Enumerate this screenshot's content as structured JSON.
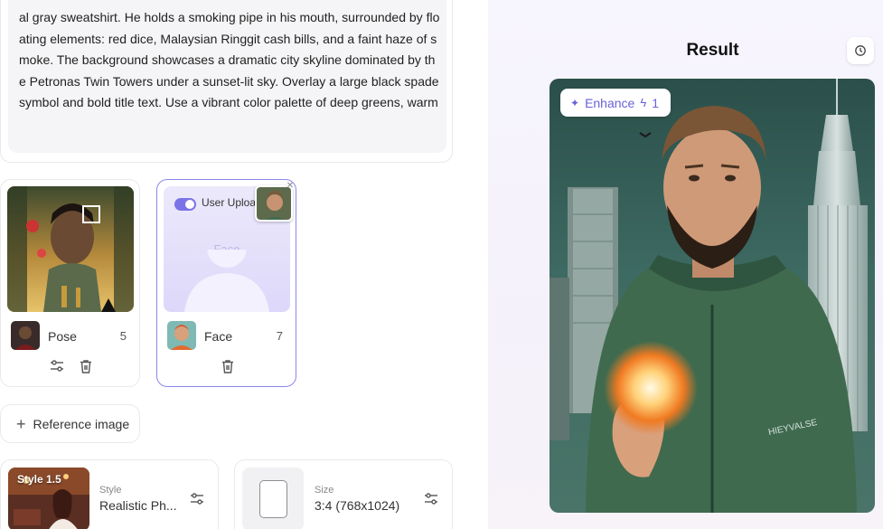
{
  "prompt": {
    "text": "al gray sweatshirt. He holds a smoking pipe in his mouth, surrounded by floating elements: red dice, Malaysian Ringgit cash bills, and a faint haze of smoke. The background showcases a dramatic city skyline dominated by the Petronas Twin Towers under a sunset-lit sky. Overlay a large black spade symbol and bold title text. Use a vibrant color palette of deep greens, warm oranges, and dark shadows to evoke themes of high-stakes gambling, urban intrigue"
  },
  "references": {
    "pose": {
      "name": "Pose",
      "count": "5"
    },
    "face": {
      "name": "Face",
      "count": "7",
      "toggle_label": "User Uploa",
      "placeholder_label": "Face"
    }
  },
  "reference_button": {
    "label": "Reference image"
  },
  "style_option": {
    "badge": "Style 1.5",
    "label": "Style",
    "value": "Realistic Ph..."
  },
  "size_option": {
    "label": "Size",
    "value": "3:4 (768x1024)"
  },
  "result": {
    "title": "Result",
    "enhance_label": "Enhance",
    "enhance_cost": "1",
    "watermark_text": "HIEYVALSE"
  },
  "colors": {
    "accent": "#7b74e6",
    "hoodie_green": "#3f6a4e",
    "sky_teal": "#2f5e55"
  },
  "icons": {
    "sliders": "sliders-icon",
    "trash": "trash-icon",
    "plus": "plus-icon",
    "history": "history-icon",
    "sparkle": "sparkle-icon",
    "bolt": "bolt-icon"
  }
}
